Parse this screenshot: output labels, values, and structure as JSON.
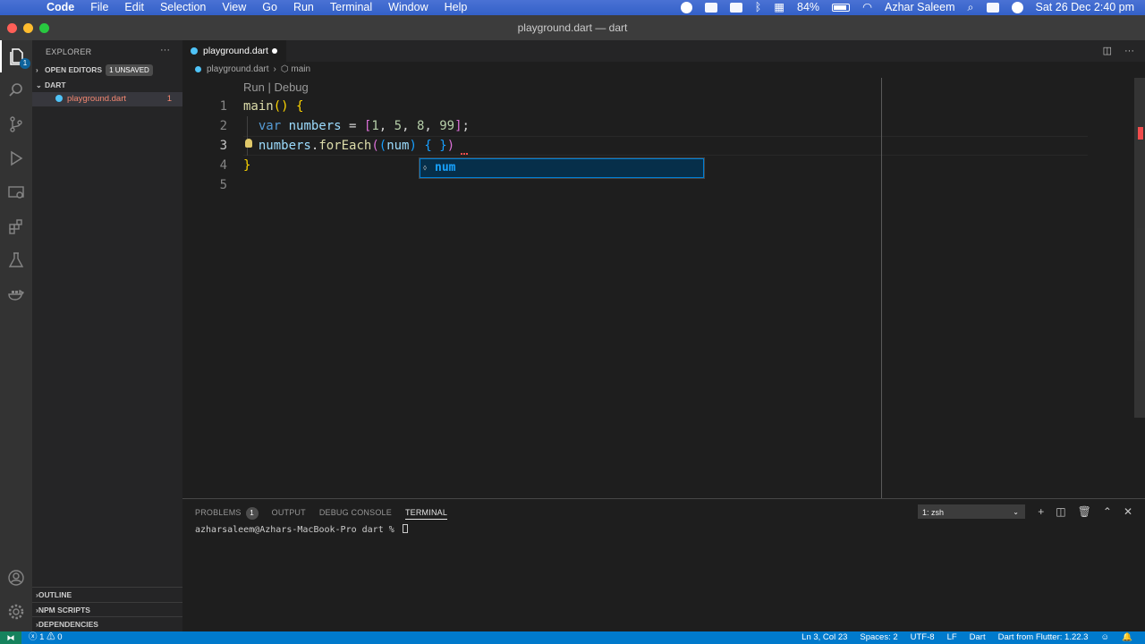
{
  "menubar": {
    "app_name": "Code",
    "items": [
      "File",
      "Edit",
      "Selection",
      "View",
      "Go",
      "Run",
      "Terminal",
      "Window",
      "Help"
    ],
    "battery": "84%",
    "user": "Azhar Saleem",
    "datetime": "Sat 26 Dec  2:40 pm"
  },
  "window": {
    "title": "playground.dart — dart"
  },
  "sidebar": {
    "title": "EXPLORER",
    "more": "···",
    "open_editors": "OPEN EDITORS",
    "unsaved_badge": "1 UNSAVED",
    "folder": "DART",
    "file": {
      "name": "playground.dart",
      "problems": "1"
    },
    "outline": "OUTLINE",
    "npm_scripts": "NPM SCRIPTS",
    "dependencies": "DEPENDENCIES"
  },
  "tab": {
    "label": "playground.dart"
  },
  "breadcrumb": {
    "file": "playground.dart",
    "symbol": "main"
  },
  "editor": {
    "codelens": "Run | Debug",
    "line_numbers": [
      "1",
      "2",
      "3",
      "4",
      "5"
    ],
    "lines": [
      [
        {
          "t": "main",
          "c": "fn"
        },
        {
          "t": "() ",
          "c": "brk"
        },
        {
          "t": "{",
          "c": "brk"
        }
      ],
      [
        {
          "t": "  ",
          "c": ""
        },
        {
          "t": "var",
          "c": "kw"
        },
        {
          "t": " ",
          "c": ""
        },
        {
          "t": "numbers",
          "c": "var"
        },
        {
          "t": " = ",
          "c": ""
        },
        {
          "t": "[",
          "c": "brk2"
        },
        {
          "t": "1",
          "c": "num"
        },
        {
          "t": ", ",
          "c": ""
        },
        {
          "t": "5",
          "c": "num"
        },
        {
          "t": ", ",
          "c": ""
        },
        {
          "t": "8",
          "c": "num"
        },
        {
          "t": ", ",
          "c": ""
        },
        {
          "t": "99",
          "c": "num"
        },
        {
          "t": "]",
          "c": "brk2"
        },
        {
          "t": ";",
          "c": ""
        }
      ],
      [
        {
          "t": "  ",
          "c": ""
        },
        {
          "t": "numbers",
          "c": "var"
        },
        {
          "t": ".",
          "c": ""
        },
        {
          "t": "forEach",
          "c": "fn"
        },
        {
          "t": "(",
          "c": "brk2"
        },
        {
          "t": "(",
          "c": "brk3"
        },
        {
          "t": "num",
          "c": "var"
        },
        {
          "t": ")",
          "c": "brk3"
        },
        {
          "t": " ",
          "c": ""
        },
        {
          "t": "{",
          "c": "brk3"
        },
        {
          "t": " ",
          "c": ""
        },
        {
          "t": "}",
          "c": "brk3"
        },
        {
          "t": ")",
          "c": "brk2"
        }
      ],
      [
        {
          "t": "}",
          "c": "brk"
        }
      ],
      []
    ],
    "suggestion": "num"
  },
  "panel": {
    "tabs": [
      "PROBLEMS",
      "OUTPUT",
      "DEBUG CONSOLE",
      "TERMINAL"
    ],
    "problems_count": "1",
    "terminal_select": "1: zsh",
    "prompt": "azharsaleem@Azhars-MacBook-Pro dart % "
  },
  "statusbar": {
    "errors": "1",
    "warnings": "0",
    "position": "Ln 3, Col 23",
    "spaces": "Spaces: 2",
    "encoding": "UTF-8",
    "eol": "LF",
    "language": "Dart",
    "sdk": "Dart from Flutter: 1.22.3"
  }
}
